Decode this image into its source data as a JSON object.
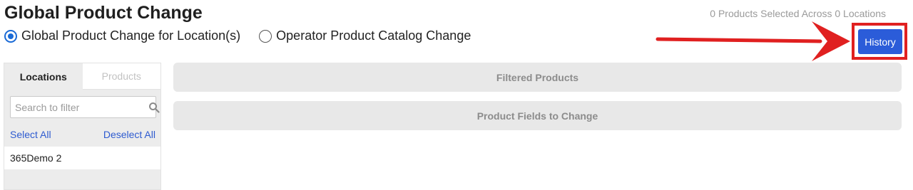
{
  "page": {
    "title": "Global Product Change",
    "selection_summary": "0 Products Selected Across 0 Locations"
  },
  "mode_options": [
    {
      "label": "Global Product Change for Location(s)",
      "selected": true
    },
    {
      "label": "Operator Product Catalog Change",
      "selected": false
    }
  ],
  "history_button": {
    "label": "History"
  },
  "left_panel": {
    "tabs": [
      {
        "label": "Locations",
        "active": true
      },
      {
        "label": "Products",
        "active": false
      }
    ],
    "search": {
      "placeholder": "Search to filter",
      "value": ""
    },
    "select_all": "Select All",
    "deselect_all": "Deselect All",
    "locations": [
      "365Demo 2"
    ]
  },
  "sections": [
    {
      "label": "Filtered Products"
    },
    {
      "label": "Product Fields to Change"
    }
  ],
  "colors": {
    "primary_button": "#2b5cd9",
    "annotation_red": "#e02020",
    "link": "#2e5bd0",
    "radio_selected": "#1a6ad6"
  }
}
